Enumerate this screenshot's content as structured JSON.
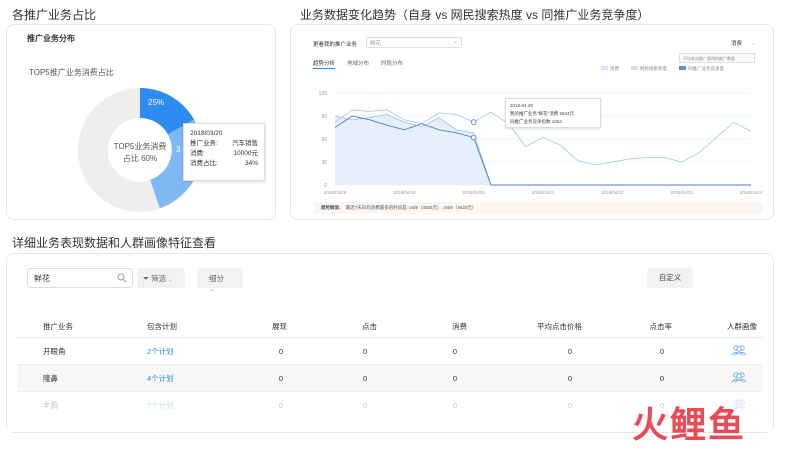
{
  "sections": {
    "left_title": "各推广业务占比",
    "right_title": "业务数据变化趋势（自身 vs 网民搜索热度 vs 同推广业务竞争度）",
    "bottom_title": "详细业务表现数据和人群画像特征查看"
  },
  "pie_card": {
    "header": "推广业务分布",
    "subtitle": "TOP5推广业务消费占比",
    "center_line1": "TOP5业务消费",
    "center_line2": "占比 60%",
    "slice_label": "25%",
    "slice_label_2": "3",
    "tooltip": {
      "date": "2018/03/20",
      "rows": [
        {
          "label": "推广业务:",
          "value": "汽车销售"
        },
        {
          "label": "消费:",
          "value": "10000元"
        },
        {
          "label": "消费占比:",
          "value": "34%"
        }
      ]
    },
    "colors": {
      "accent": "#2d8cf0",
      "light": "#7fb8f5",
      "rest": "#eeeeee"
    }
  },
  "trend_card": {
    "select_label": "更看我的推广业务",
    "select_value": "鲜花",
    "right_select": "消费",
    "tabs": [
      "趋势分析",
      "地域分布",
      "时段分布"
    ],
    "hint": "平均单次推广获得的推广数量",
    "legend": [
      "消费",
      "网民搜索热度",
      "同推广业务竞争度"
    ],
    "y_ticks": [
      "120",
      "90",
      "60",
      "30",
      "0"
    ],
    "x_ticks": [
      "2018/04/18",
      "2018/04/19",
      "2018/04/20",
      "2018/04/21",
      "2018/04/22",
      "2018/04/23",
      "2018/04/24"
    ],
    "tooltip": {
      "date": "2018-04-20",
      "line1": "我的推广业务\"鲜花\"消费   2644元",
      "line2": "同推广业务竞争指数   1062"
    },
    "footer_label": "趋势解读:",
    "footer_text": "最近7天日均消费最多的时间是: 04/8（4555元）, 04/9（4620元）"
  },
  "chart_data": {
    "type": "line",
    "x": [
      "2018/04/18",
      "2018/04/19",
      "2018/04/20",
      "2018/04/21",
      "2018/04/22",
      "2018/04/23",
      "2018/04/24"
    ],
    "ylim": [
      0,
      120
    ],
    "series": [
      {
        "name": "消费",
        "values": [
          90,
          85,
          88,
          92,
          82,
          76,
          88,
          72,
          68,
          0,
          0,
          0,
          0,
          0,
          0,
          0,
          0,
          0,
          0,
          0,
          0,
          0,
          0,
          0,
          0
        ]
      },
      {
        "name": "网民搜索热度",
        "values": [
          82,
          98,
          96,
          98,
          85,
          80,
          94,
          92,
          82,
          95,
          80,
          50,
          62,
          52,
          32,
          26,
          30,
          34,
          36,
          36,
          30,
          42,
          62,
          82,
          70
        ]
      },
      {
        "name": "同推广业务竞争度",
        "values": [
          75,
          90,
          85,
          78,
          72,
          80,
          72,
          68,
          62,
          0,
          0,
          0,
          0,
          0,
          0,
          0,
          0,
          0,
          0,
          0,
          0,
          0,
          0,
          0,
          0
        ]
      }
    ]
  },
  "table_card": {
    "search_value": "鲜花",
    "filter_label": "筛选",
    "segment_label": "细分",
    "custom_button": "自定义",
    "headers": [
      "推广业务",
      "包含计划",
      "展现",
      "点击",
      "消费",
      "平均点击价格",
      "点击率",
      "人群画像"
    ],
    "rows": [
      {
        "name": "开眼角",
        "plans": "2个计划",
        "show": "0",
        "click": "0",
        "cost": "0",
        "avg": "0",
        "ctr": "0"
      },
      {
        "name": "隆鼻",
        "plans": "4个计划",
        "show": "0",
        "click": "0",
        "cost": "0",
        "avg": "0",
        "ctr": "0"
      },
      {
        "name": "丰胸",
        "plans": "7个计划",
        "show": "0",
        "click": "0",
        "cost": "0",
        "avg": "0",
        "ctr": "0"
      }
    ]
  },
  "watermark": "火鲤鱼"
}
